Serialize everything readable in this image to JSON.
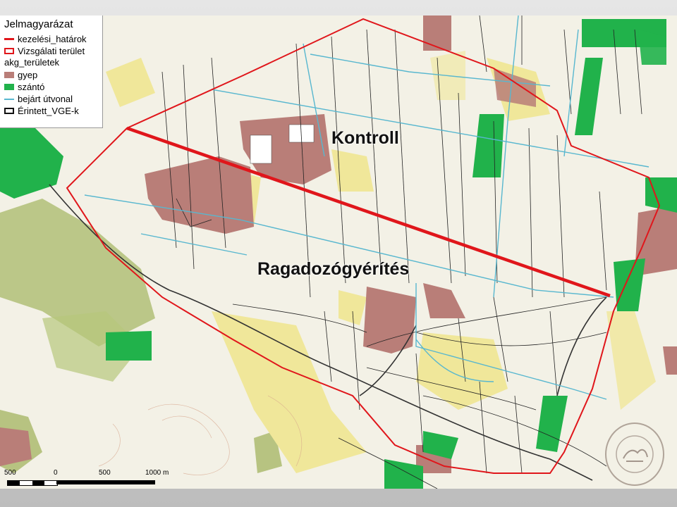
{
  "legend": {
    "title": "Jelmagyarázat",
    "items": [
      {
        "label": "kezelési_határok",
        "type": "line",
        "color": "#e0161b"
      },
      {
        "label": "Vizsgálati terület",
        "type": "outline",
        "color": "#e0161b"
      },
      {
        "label": "akg_területek",
        "type": "heading"
      },
      {
        "label": "gyep",
        "type": "fill",
        "color": "#b97e78"
      },
      {
        "label": "szántó",
        "type": "fill",
        "color": "#21b24b"
      },
      {
        "label": "bejárt útvonal",
        "type": "line",
        "color": "#58b7cf"
      },
      {
        "label": "Érintett_VGE-k",
        "type": "outline",
        "color": "#111111"
      }
    ]
  },
  "map": {
    "label_control": "Kontroll",
    "label_treatment": "Ragadozógyérítés",
    "colors": {
      "boundary": "#e0161b",
      "route": "#58b7cf",
      "grassland": "#b97e78",
      "arable": "#21b24b",
      "yellow_area": "#f0e79a",
      "olive_area": "#a8b868"
    }
  },
  "scale": {
    "labels": [
      "500",
      "0",
      "500",
      "1000 m"
    ]
  },
  "seal": {
    "icon": "university-seal-icon"
  }
}
